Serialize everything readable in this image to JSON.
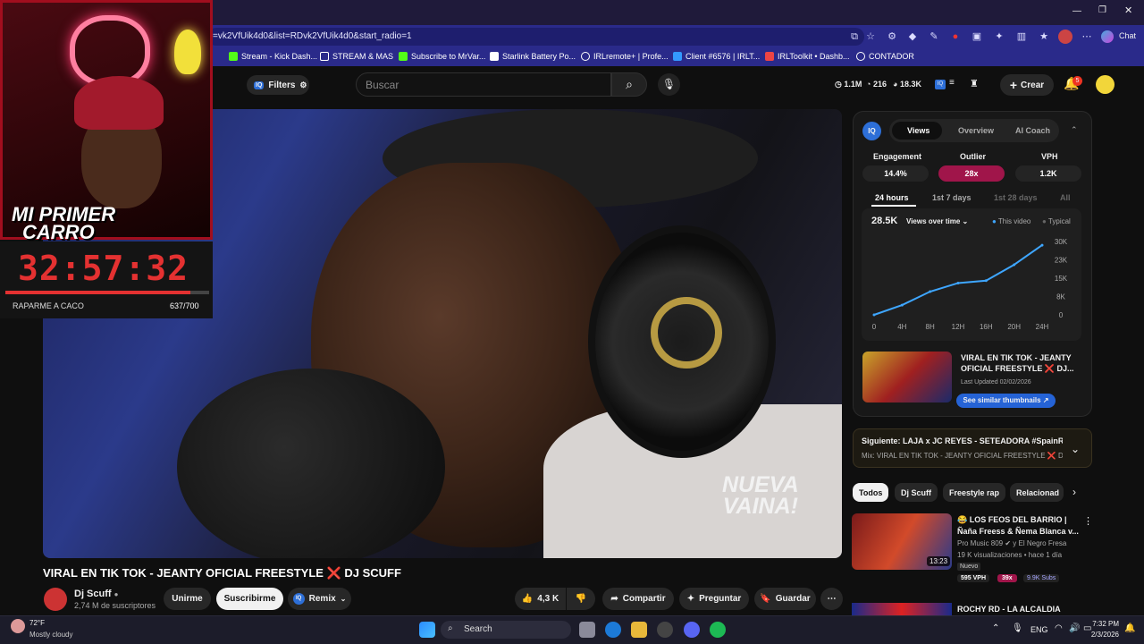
{
  "browser": {
    "url": "=vk2VfUik4d0&list=RDvk2VfUik4d0&start_radio=1",
    "chat_label": "Chat",
    "bookmarks": [
      "Stream - Kick Dash...",
      "STREAM & MAS",
      "Subscribe to MrVar...",
      "Starlink Battery Po...",
      "IRLremote+ | Profe...",
      "Client #6576 | IRLT...",
      "IRLToolkit • Dashb...",
      "CONTADOR"
    ]
  },
  "youtube": {
    "filters_label": "Filters",
    "search_placeholder": "Buscar",
    "stats": {
      "views": "1.1M",
      "likes": "216",
      "subs": "18.3K"
    },
    "crear_label": "Crear",
    "notif_count": "5"
  },
  "video": {
    "watermark_line1": "NUEVA",
    "watermark_line2": "VAINA!",
    "title": "VIRAL EN TIK TOK - JEANTY OFICIAL FREESTYLE ❌ DJ SCUFF",
    "channel": "Dj Scuff",
    "subscribers": "2,74 M de suscriptores",
    "join_label": "Unirme",
    "subscribe_label": "Suscribirme",
    "remix_label": "Remix",
    "likes": "4,3 K",
    "share_label": "Compartir",
    "ask_label": "Preguntar",
    "save_label": "Guardar"
  },
  "overlay": {
    "banner_line1": "MI PRIMER",
    "banner_line2": "CARRO",
    "timer": "32:57:32",
    "goal_name": "RAPARME A CACO",
    "goal_count": "637/700",
    "goal_progress": 0.91
  },
  "iq_panel": {
    "logo": "IQ",
    "tabs": [
      "Views",
      "Overview",
      "AI Coach"
    ],
    "metrics": [
      {
        "label": "Engagement",
        "value": "14.4%"
      },
      {
        "label": "Outlier",
        "value": "28x"
      },
      {
        "label": "VPH",
        "value": "1.2K"
      }
    ],
    "ranges": [
      "24 hours",
      "1st 7 days",
      "1st 28 days",
      "All"
    ],
    "chart_value": "28.5K",
    "chart_mode": "Views over time",
    "legend_this": "This video",
    "legend_typical": "Typical",
    "thumb_title": "VIRAL EN TIK TOK - JEANTY OFICIAL FREESTYLE ❌ DJ...",
    "last_updated": "Last Updated 02/02/2026",
    "similar_label": "See similar thumbnails ↗"
  },
  "chart_data": {
    "type": "line",
    "x": [
      "0",
      "4H",
      "8H",
      "12H",
      "16H",
      "20H",
      "24H"
    ],
    "y_ticks": [
      "30K",
      "23K",
      "15K",
      "8K",
      "0"
    ],
    "ylim": [
      0,
      30000
    ],
    "series": [
      {
        "name": "This video",
        "color": "#3ea6ff",
        "values": [
          0,
          4000,
          9500,
          13000,
          14000,
          20500,
          28500
        ]
      }
    ]
  },
  "next_up": {
    "title": "Siguiente: LAJA x JC REYES - SETEADORA #SpainR...",
    "subtitle": "Mix: VIRAL EN TIK TOK - JEANTY OFICIAL FREESTYLE ❌ D..."
  },
  "chips": [
    "Todos",
    "Dj Scuff",
    "Freestyle rap",
    "Relacionad"
  ],
  "related": [
    {
      "title_line1": "😂 LOS FEOS DEL BARRIO |",
      "title_line2": "Ñaña Freess & Ñema Blanca v...",
      "channel": "Pro Music 809 ✔ y El Negro Fresa",
      "meta": "19 K visualizaciones • hace 1 día",
      "badge": "Nuevo",
      "duration": "13:23",
      "vph": "595 VPH",
      "outlier": "39x",
      "subs": "9.9K Subs"
    },
    {
      "title_line1": "ROCHY RD - LA ALCALDIA"
    }
  ],
  "taskbar": {
    "temp": "72°F",
    "weather": "Mostly cloudy",
    "search": "Search",
    "lang": "ENG",
    "time": "7:32 PM",
    "date": "2/3/2026"
  }
}
